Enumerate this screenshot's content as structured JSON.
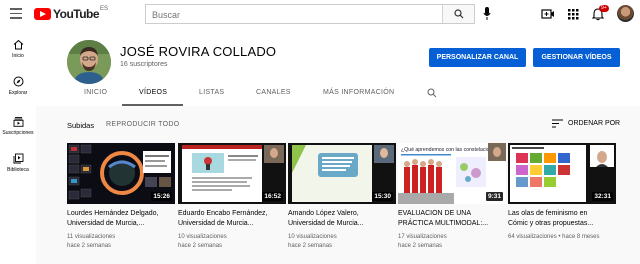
{
  "topbar": {
    "logo_text": "YouTube",
    "country": "ES",
    "search_placeholder": "Buscar",
    "notification_count": "9+"
  },
  "sidebar": {
    "items": [
      {
        "label": "Inicio",
        "icon": "home-icon"
      },
      {
        "label": "Explorar",
        "icon": "compass-icon"
      },
      {
        "label": "Suscripciones",
        "icon": "subscriptions-icon"
      },
      {
        "label": "Biblioteca",
        "icon": "library-icon"
      }
    ]
  },
  "channel": {
    "name": "JOSÉ ROVIRA COLLADO",
    "subscribers": "16 suscriptores",
    "customize_label": "PERSONALIZAR CANAL",
    "manage_label": "GESTIONAR VÍDEOS"
  },
  "tabs": [
    "INICIO",
    "VÍDEOS",
    "LISTAS",
    "CANALES",
    "MÁS INFORMACIÓN"
  ],
  "active_tab": "VÍDEOS",
  "section": {
    "title": "Subidas",
    "play_all": "REPRODUCIR TODO",
    "sort_label": "ORDENAR POR"
  },
  "videos": [
    {
      "title_line1": "Lourdes Hernández Delgado,",
      "title_line2": "Universidad de Murcia,...",
      "views": "11 visualizaciones",
      "age": "hace 2 semanas",
      "duration": "15:26"
    },
    {
      "title_line1": "Eduardo Encabo Fernández,",
      "title_line2": "Universidad de Murcia...",
      "views": "10 visualizaciones",
      "age": "hace 2 semanas",
      "duration": "16:52"
    },
    {
      "title_line1": "Amando López Valero,",
      "title_line2": "Universidad de Murcia...",
      "views": "10 visualizaciones",
      "age": "hace 2 semanas",
      "duration": "15:30"
    },
    {
      "title_line1": "EVALUACIÓN DE UNA",
      "title_line2": "PRÁCTICA MULTIMODAL:...",
      "views": "17 visualizaciones",
      "age": "hace 2 semanas",
      "duration": "9:31",
      "thumb_heading": "¿Qué aprendemos con las constelaciones?"
    },
    {
      "title_line1": "Las olas de feminismo en",
      "title_line2": "Cómic y otras propuestas...",
      "views": "64 visualizaciones",
      "age": "hace 8 meses",
      "duration": "32:31"
    }
  ]
}
